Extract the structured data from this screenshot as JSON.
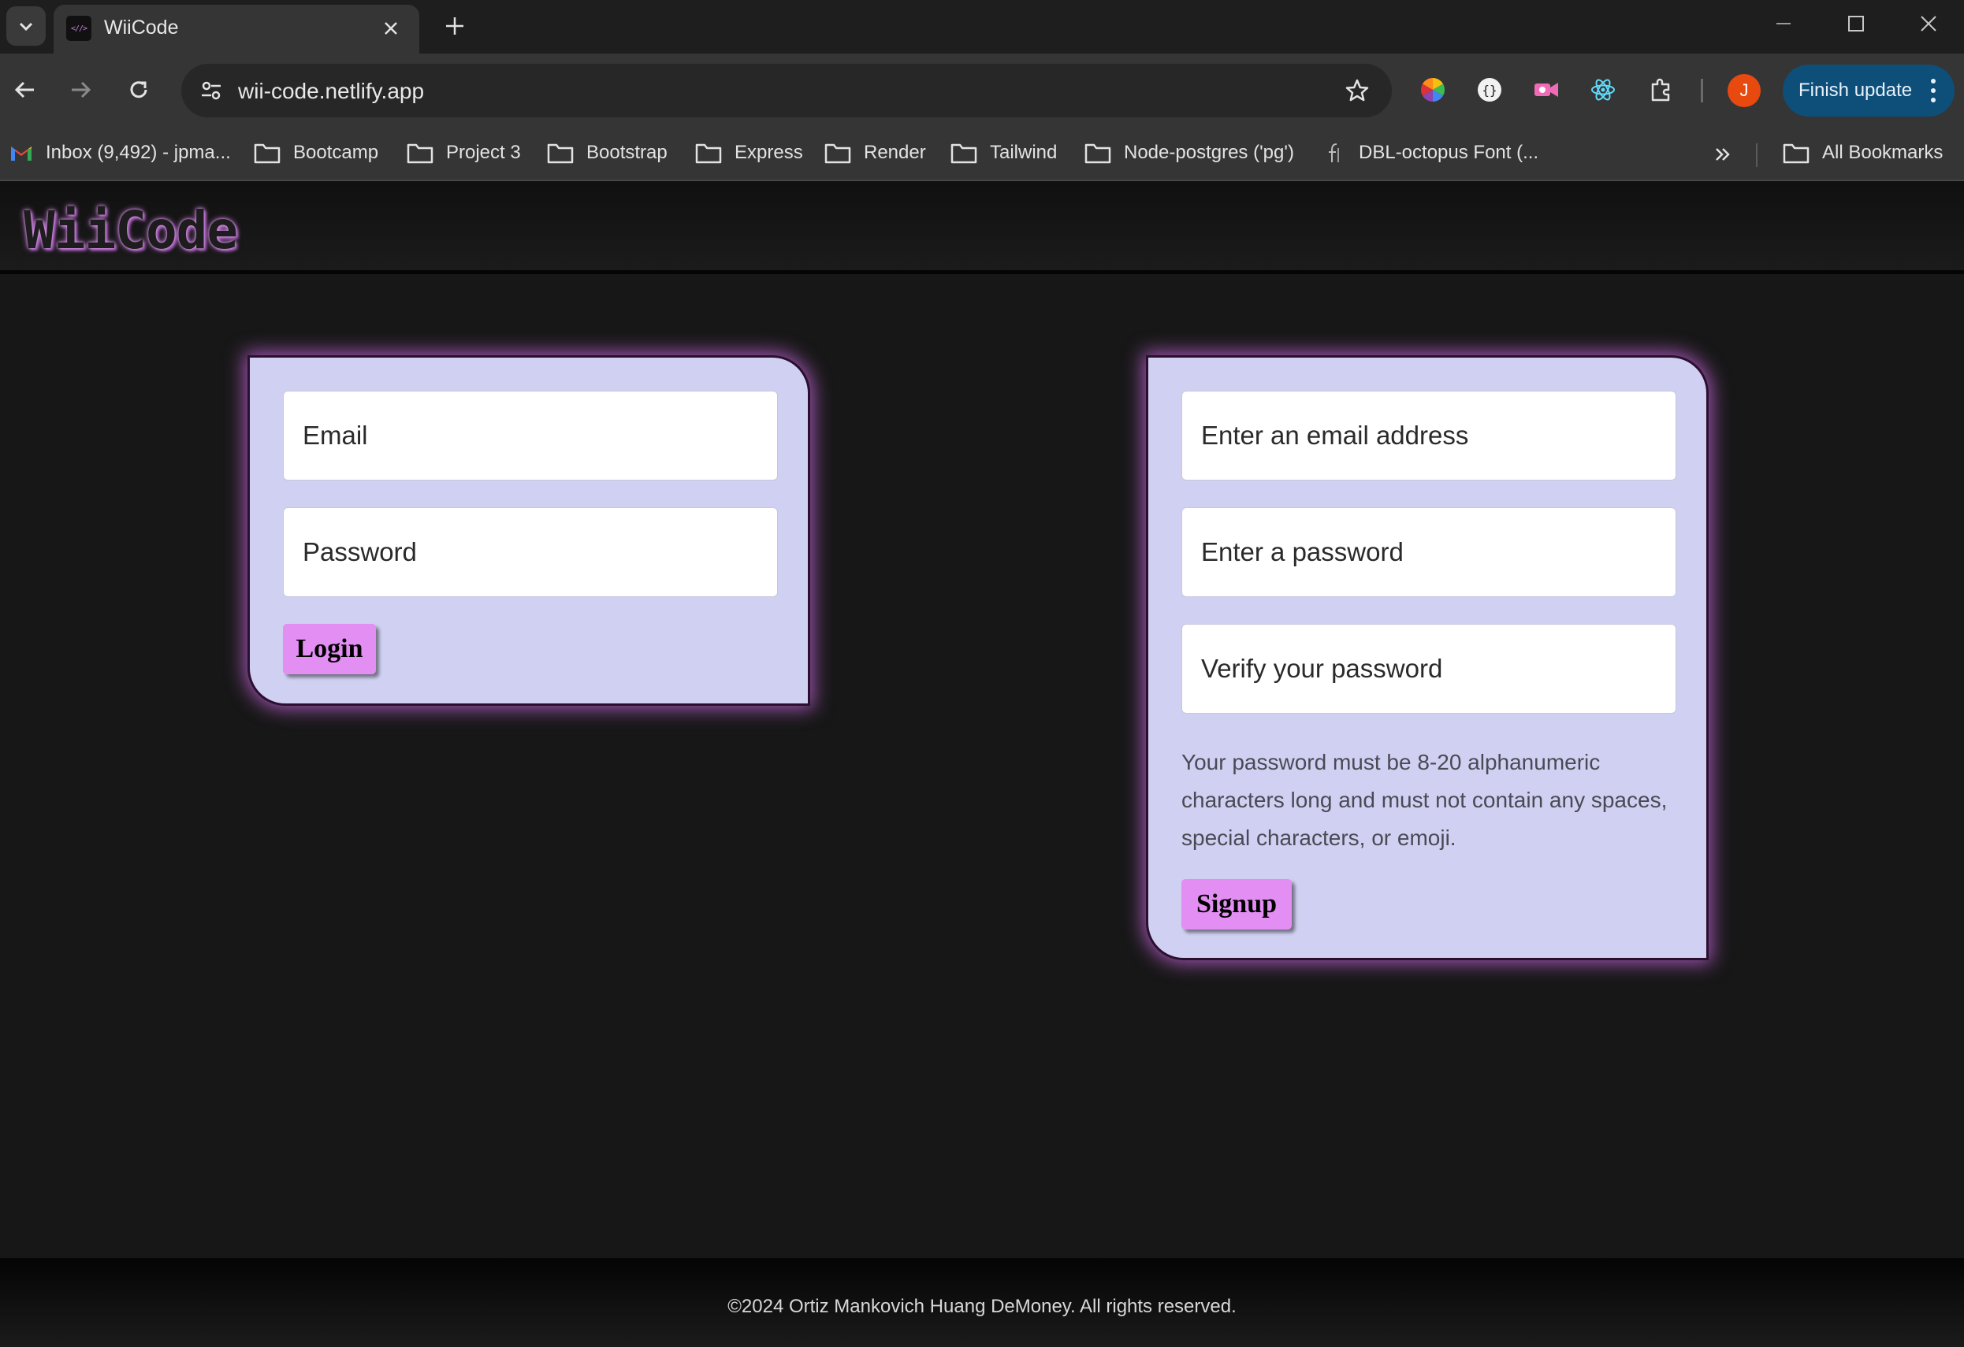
{
  "browser": {
    "tab_title": "WiiCode",
    "favicon_text": "<//>",
    "url": "wii-code.netlify.app",
    "profile_initial": "J",
    "update_label": "Finish update",
    "bookmarks": [
      {
        "label": "Inbox (9,492) - jpma...",
        "icon": "gmail-icon"
      },
      {
        "label": "Bootcamp",
        "icon": "folder-icon"
      },
      {
        "label": "Project 3",
        "icon": "folder-icon"
      },
      {
        "label": "Bootstrap",
        "icon": "folder-icon"
      },
      {
        "label": "Express",
        "icon": "folder-icon"
      },
      {
        "label": "Render",
        "icon": "folder-icon"
      },
      {
        "label": "Tailwind",
        "icon": "folder-icon"
      },
      {
        "label": "Node-postgres ('pg')",
        "icon": "folder-icon"
      },
      {
        "label": "DBL-octopus Font (...",
        "icon": "font-icon"
      }
    ],
    "all_bookmarks_label": "All Bookmarks"
  },
  "header": {
    "logo": "WiiCode"
  },
  "login": {
    "email_placeholder": "Email",
    "password_placeholder": "Password",
    "button_label": "Login"
  },
  "signup": {
    "email_placeholder": "Enter an email address",
    "password_placeholder": "Enter a password",
    "verify_placeholder": "Verify your password",
    "hint": "Your password must be 8-20 alphanumeric characters long and must not contain any spaces, special characters, or emoji.",
    "button_label": "Signup"
  },
  "footer": {
    "text": "©2024 Ortiz Mankovich Huang DeMoney. All rights reserved."
  },
  "colors": {
    "card_bg": "#d0d0f2",
    "button_bg": "#e38ef2",
    "glow": "#ce69e6",
    "page_bg": "#171717",
    "update_button": "#0e4f7a"
  }
}
